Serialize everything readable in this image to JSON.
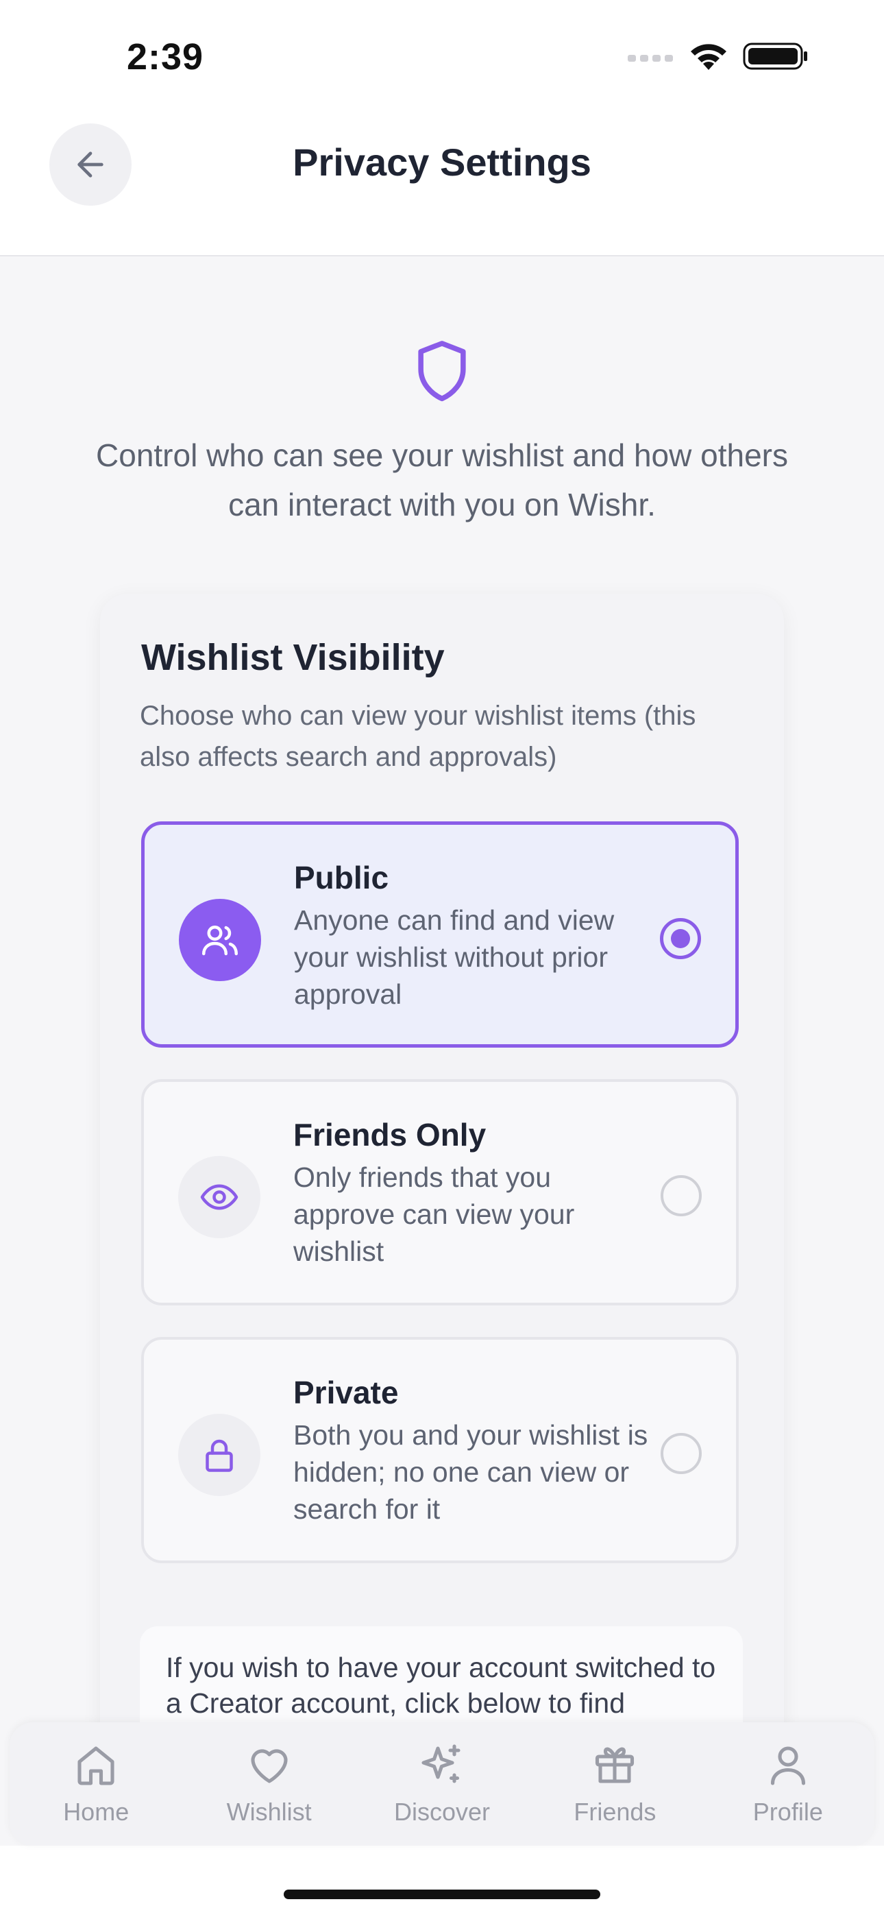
{
  "status_bar": {
    "time": "2:39"
  },
  "header": {
    "title": "Privacy Settings"
  },
  "intro": {
    "text": "Control who can see your wishlist and how others can interact with you on Wishr."
  },
  "visibility": {
    "title": "Wishlist Visibility",
    "description": "Choose who can view your wishlist items (this also affects search and approvals)",
    "selected": "public",
    "options": [
      {
        "id": "public",
        "title": "Public",
        "description": "Anyone can find and view your wishlist without prior approval",
        "icon": "users-icon"
      },
      {
        "id": "friends",
        "title": "Friends Only",
        "description": "Only friends that you approve can view your wishlist",
        "icon": "eye-icon"
      },
      {
        "id": "private",
        "title": "Private",
        "description": "Both you and your wishlist is hidden; no one can view or search for it",
        "icon": "lock-icon"
      }
    ]
  },
  "creator": {
    "text": "If you wish to have your account switched to a Creator account, click below to find"
  },
  "tabs": [
    {
      "label": "Home",
      "icon": "home-icon"
    },
    {
      "label": "Wishlist",
      "icon": "heart-icon"
    },
    {
      "label": "Discover",
      "icon": "sparkles-icon"
    },
    {
      "label": "Friends",
      "icon": "gift-icon"
    },
    {
      "label": "Profile",
      "icon": "person-icon"
    }
  ],
  "colors": {
    "accent": "#8a5ce8",
    "selected_bg": "#eceefb",
    "text": "#1f2433",
    "muted": "#5c6270"
  }
}
